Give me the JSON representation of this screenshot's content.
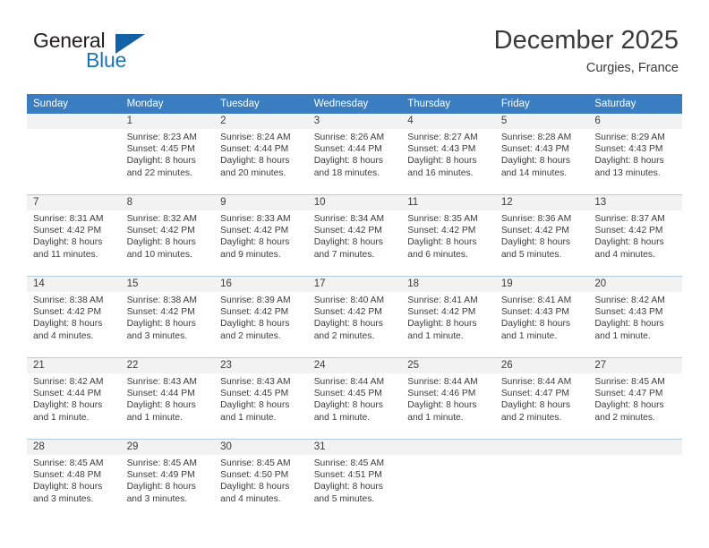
{
  "brand": {
    "general": "General",
    "blue": "Blue",
    "triangle_icon": "brand-triangle-icon"
  },
  "header": {
    "month_title": "December 2025",
    "location": "Curgies, France"
  },
  "calendar": {
    "weekday_headers": [
      "Sunday",
      "Monday",
      "Tuesday",
      "Wednesday",
      "Thursday",
      "Friday",
      "Saturday"
    ],
    "header_bg": "#3a7dc0",
    "daynum_bg": "#f2f2f2",
    "grid_line": "#b5cde2",
    "weeks": [
      [
        {
          "day": "",
          "sunrise": "",
          "sunset": "",
          "daylight1": "",
          "daylight2": ""
        },
        {
          "day": "1",
          "sunrise": "Sunrise: 8:23 AM",
          "sunset": "Sunset: 4:45 PM",
          "daylight1": "Daylight: 8 hours",
          "daylight2": "and 22 minutes."
        },
        {
          "day": "2",
          "sunrise": "Sunrise: 8:24 AM",
          "sunset": "Sunset: 4:44 PM",
          "daylight1": "Daylight: 8 hours",
          "daylight2": "and 20 minutes."
        },
        {
          "day": "3",
          "sunrise": "Sunrise: 8:26 AM",
          "sunset": "Sunset: 4:44 PM",
          "daylight1": "Daylight: 8 hours",
          "daylight2": "and 18 minutes."
        },
        {
          "day": "4",
          "sunrise": "Sunrise: 8:27 AM",
          "sunset": "Sunset: 4:43 PM",
          "daylight1": "Daylight: 8 hours",
          "daylight2": "and 16 minutes."
        },
        {
          "day": "5",
          "sunrise": "Sunrise: 8:28 AM",
          "sunset": "Sunset: 4:43 PM",
          "daylight1": "Daylight: 8 hours",
          "daylight2": "and 14 minutes."
        },
        {
          "day": "6",
          "sunrise": "Sunrise: 8:29 AM",
          "sunset": "Sunset: 4:43 PM",
          "daylight1": "Daylight: 8 hours",
          "daylight2": "and 13 minutes."
        }
      ],
      [
        {
          "day": "7",
          "sunrise": "Sunrise: 8:31 AM",
          "sunset": "Sunset: 4:42 PM",
          "daylight1": "Daylight: 8 hours",
          "daylight2": "and 11 minutes."
        },
        {
          "day": "8",
          "sunrise": "Sunrise: 8:32 AM",
          "sunset": "Sunset: 4:42 PM",
          "daylight1": "Daylight: 8 hours",
          "daylight2": "and 10 minutes."
        },
        {
          "day": "9",
          "sunrise": "Sunrise: 8:33 AM",
          "sunset": "Sunset: 4:42 PM",
          "daylight1": "Daylight: 8 hours",
          "daylight2": "and 9 minutes."
        },
        {
          "day": "10",
          "sunrise": "Sunrise: 8:34 AM",
          "sunset": "Sunset: 4:42 PM",
          "daylight1": "Daylight: 8 hours",
          "daylight2": "and 7 minutes."
        },
        {
          "day": "11",
          "sunrise": "Sunrise: 8:35 AM",
          "sunset": "Sunset: 4:42 PM",
          "daylight1": "Daylight: 8 hours",
          "daylight2": "and 6 minutes."
        },
        {
          "day": "12",
          "sunrise": "Sunrise: 8:36 AM",
          "sunset": "Sunset: 4:42 PM",
          "daylight1": "Daylight: 8 hours",
          "daylight2": "and 5 minutes."
        },
        {
          "day": "13",
          "sunrise": "Sunrise: 8:37 AM",
          "sunset": "Sunset: 4:42 PM",
          "daylight1": "Daylight: 8 hours",
          "daylight2": "and 4 minutes."
        }
      ],
      [
        {
          "day": "14",
          "sunrise": "Sunrise: 8:38 AM",
          "sunset": "Sunset: 4:42 PM",
          "daylight1": "Daylight: 8 hours",
          "daylight2": "and 4 minutes."
        },
        {
          "day": "15",
          "sunrise": "Sunrise: 8:38 AM",
          "sunset": "Sunset: 4:42 PM",
          "daylight1": "Daylight: 8 hours",
          "daylight2": "and 3 minutes."
        },
        {
          "day": "16",
          "sunrise": "Sunrise: 8:39 AM",
          "sunset": "Sunset: 4:42 PM",
          "daylight1": "Daylight: 8 hours",
          "daylight2": "and 2 minutes."
        },
        {
          "day": "17",
          "sunrise": "Sunrise: 8:40 AM",
          "sunset": "Sunset: 4:42 PM",
          "daylight1": "Daylight: 8 hours",
          "daylight2": "and 2 minutes."
        },
        {
          "day": "18",
          "sunrise": "Sunrise: 8:41 AM",
          "sunset": "Sunset: 4:42 PM",
          "daylight1": "Daylight: 8 hours",
          "daylight2": "and 1 minute."
        },
        {
          "day": "19",
          "sunrise": "Sunrise: 8:41 AM",
          "sunset": "Sunset: 4:43 PM",
          "daylight1": "Daylight: 8 hours",
          "daylight2": "and 1 minute."
        },
        {
          "day": "20",
          "sunrise": "Sunrise: 8:42 AM",
          "sunset": "Sunset: 4:43 PM",
          "daylight1": "Daylight: 8 hours",
          "daylight2": "and 1 minute."
        }
      ],
      [
        {
          "day": "21",
          "sunrise": "Sunrise: 8:42 AM",
          "sunset": "Sunset: 4:44 PM",
          "daylight1": "Daylight: 8 hours",
          "daylight2": "and 1 minute."
        },
        {
          "day": "22",
          "sunrise": "Sunrise: 8:43 AM",
          "sunset": "Sunset: 4:44 PM",
          "daylight1": "Daylight: 8 hours",
          "daylight2": "and 1 minute."
        },
        {
          "day": "23",
          "sunrise": "Sunrise: 8:43 AM",
          "sunset": "Sunset: 4:45 PM",
          "daylight1": "Daylight: 8 hours",
          "daylight2": "and 1 minute."
        },
        {
          "day": "24",
          "sunrise": "Sunrise: 8:44 AM",
          "sunset": "Sunset: 4:45 PM",
          "daylight1": "Daylight: 8 hours",
          "daylight2": "and 1 minute."
        },
        {
          "day": "25",
          "sunrise": "Sunrise: 8:44 AM",
          "sunset": "Sunset: 4:46 PM",
          "daylight1": "Daylight: 8 hours",
          "daylight2": "and 1 minute."
        },
        {
          "day": "26",
          "sunrise": "Sunrise: 8:44 AM",
          "sunset": "Sunset: 4:47 PM",
          "daylight1": "Daylight: 8 hours",
          "daylight2": "and 2 minutes."
        },
        {
          "day": "27",
          "sunrise": "Sunrise: 8:45 AM",
          "sunset": "Sunset: 4:47 PM",
          "daylight1": "Daylight: 8 hours",
          "daylight2": "and 2 minutes."
        }
      ],
      [
        {
          "day": "28",
          "sunrise": "Sunrise: 8:45 AM",
          "sunset": "Sunset: 4:48 PM",
          "daylight1": "Daylight: 8 hours",
          "daylight2": "and 3 minutes."
        },
        {
          "day": "29",
          "sunrise": "Sunrise: 8:45 AM",
          "sunset": "Sunset: 4:49 PM",
          "daylight1": "Daylight: 8 hours",
          "daylight2": "and 3 minutes."
        },
        {
          "day": "30",
          "sunrise": "Sunrise: 8:45 AM",
          "sunset": "Sunset: 4:50 PM",
          "daylight1": "Daylight: 8 hours",
          "daylight2": "and 4 minutes."
        },
        {
          "day": "31",
          "sunrise": "Sunrise: 8:45 AM",
          "sunset": "Sunset: 4:51 PM",
          "daylight1": "Daylight: 8 hours",
          "daylight2": "and 5 minutes."
        },
        {
          "day": "",
          "sunrise": "",
          "sunset": "",
          "daylight1": "",
          "daylight2": ""
        },
        {
          "day": "",
          "sunrise": "",
          "sunset": "",
          "daylight1": "",
          "daylight2": ""
        },
        {
          "day": "",
          "sunrise": "",
          "sunset": "",
          "daylight1": "",
          "daylight2": ""
        }
      ]
    ]
  }
}
